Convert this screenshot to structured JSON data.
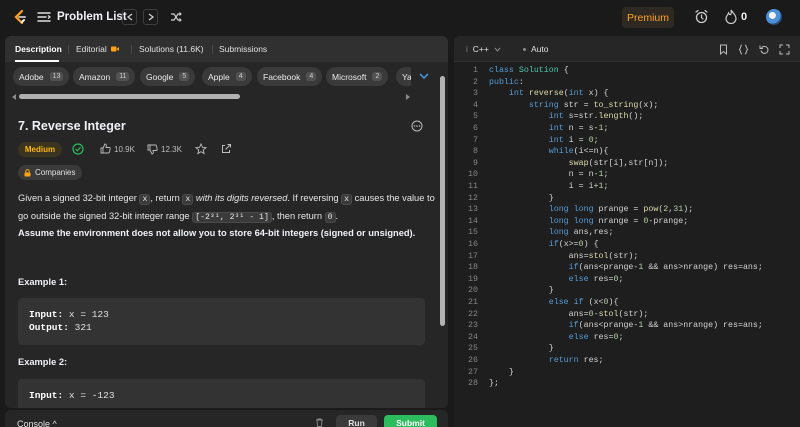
{
  "topbar": {
    "title": "Problem List",
    "prev_icon": "chevron-left-icon",
    "next_icon": "chevron-right-icon",
    "shuffle_icon": "shuffle-icon",
    "premium_label": "Premium",
    "alarm_icon": "alarm-clock-icon",
    "fire_icon": "fire-icon",
    "streak_count": "0",
    "avatar_icon": "avatar-icon"
  },
  "tabs": [
    {
      "label": "Description",
      "active": true
    },
    {
      "label": "Editorial"
    },
    {
      "label": "Solutions (11.6K)"
    },
    {
      "label": "Submissions"
    }
  ],
  "companies": [
    {
      "name": "Adobe",
      "count": "13"
    },
    {
      "name": "Amazon",
      "count": "11"
    },
    {
      "name": "Google",
      "count": "5"
    },
    {
      "name": "Apple",
      "count": "4"
    },
    {
      "name": "Facebook",
      "count": "4"
    },
    {
      "name": "Microsoft",
      "count": "2"
    },
    {
      "name": "Ya",
      "count": ""
    }
  ],
  "problem": {
    "title": "7. Reverse Integer",
    "difficulty": "Medium",
    "likes": "10.9K",
    "dislikes": "12.3K",
    "companies_label": "Companies",
    "desc_part1": "Given a signed 32-bit integer ",
    "desc_code_x1": "x",
    "desc_part2": ", return ",
    "desc_code_x2": "x",
    "desc_italic": " with its digits reversed",
    "desc_part3": ". If reversing ",
    "desc_code_x3": "x",
    "desc_part4": " causes the value to go outside the signed 32-bit integer range ",
    "desc_range": "[-2³¹, 2³¹ - 1]",
    "desc_part5": ", then return ",
    "desc_zero": "0",
    "desc_part6": ".",
    "note": "Assume the environment does not allow you to store 64-bit integers (signed or unsigned).",
    "example1_title": "Example 1:",
    "example1_input_label": "Input:",
    "example1_input": " x = 123",
    "example1_output_label": "Output:",
    "example1_output": " 321",
    "example2_title": "Example 2:",
    "example2_input_label": "Input:",
    "example2_input": " x = -123"
  },
  "bottom": {
    "console_label": "Console ^",
    "run_label": "Run",
    "submit_label": "Submit"
  },
  "editor": {
    "language": "C++",
    "mode": "Auto",
    "lines": [
      "class Solution {",
      "public:",
      "    int reverse(int x) {",
      "        string str = to_string(x);",
      "            int s=str.length();",
      "            int n = s-1;",
      "            int i = 0;",
      "            while(i<=n){",
      "                swap(str[i],str[n]);",
      "                n = n-1;",
      "                i = i+1;",
      "            }",
      "            long long prange = pow(2,31);",
      "            long long nrange = 0-prange;",
      "            long ans,res;",
      "            if(x>=0) {",
      "                ans=stol(str);",
      "                if(ans<prange-1 && ans>nrange) res=ans;",
      "                else res=0;",
      "            }",
      "            else if (x<0){",
      "                ans=0-stol(str);",
      "                if(ans<prange-1 && ans>nrange) res=ans;",
      "                else res=0;",
      "            }",
      "            return res;",
      "    }",
      "};"
    ]
  },
  "colors": {
    "accent": "#ffa116",
    "medium": "#ffb800",
    "success": "#2cbb5d"
  }
}
